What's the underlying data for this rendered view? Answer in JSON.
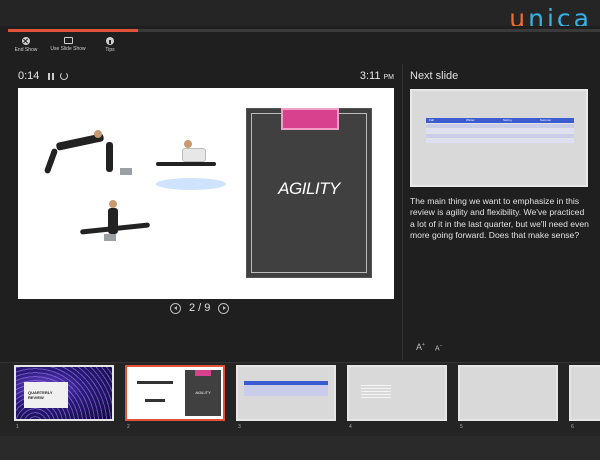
{
  "brand": {
    "u": "u",
    "rest": "nica"
  },
  "presenter": {
    "toolbar": [
      {
        "label": "End Show",
        "icon": "close-circle-icon"
      },
      {
        "label": "Use Slide Show",
        "icon": "monitor-icon"
      },
      {
        "label": "Tips",
        "icon": "info-icon"
      }
    ],
    "progress_fraction": 0.22,
    "elapsed": "0:14",
    "clock": "3:11",
    "clock_ampm": "PM",
    "current_slide": {
      "title": "AGILITY"
    },
    "pager": "2 / 9",
    "next_slide_label": "Next slide",
    "next_slide_table_headers": [
      "Fall",
      "Winter",
      "Spring",
      "Summer"
    ],
    "notes": "The main thing we want to emphasize in this  review is agility and flexibility. We've practiced a lot of it in the last quarter, but we'll need even more going forward. Does that make sense?",
    "font_controls": {
      "increase": "A",
      "decrease": "A"
    },
    "thumbnails": [
      {
        "num": "1",
        "text": "QUARTERLY REVIEW"
      },
      {
        "num": "2",
        "text": "AGILITY"
      },
      {
        "num": "3",
        "text": ""
      },
      {
        "num": "4",
        "text": ""
      },
      {
        "num": "5",
        "text": ""
      },
      {
        "num": "6",
        "text": ""
      }
    ],
    "colors": {
      "accent": "#e2533b",
      "agility_tab": "#d8418d",
      "table_header": "#3b5bd1"
    }
  }
}
